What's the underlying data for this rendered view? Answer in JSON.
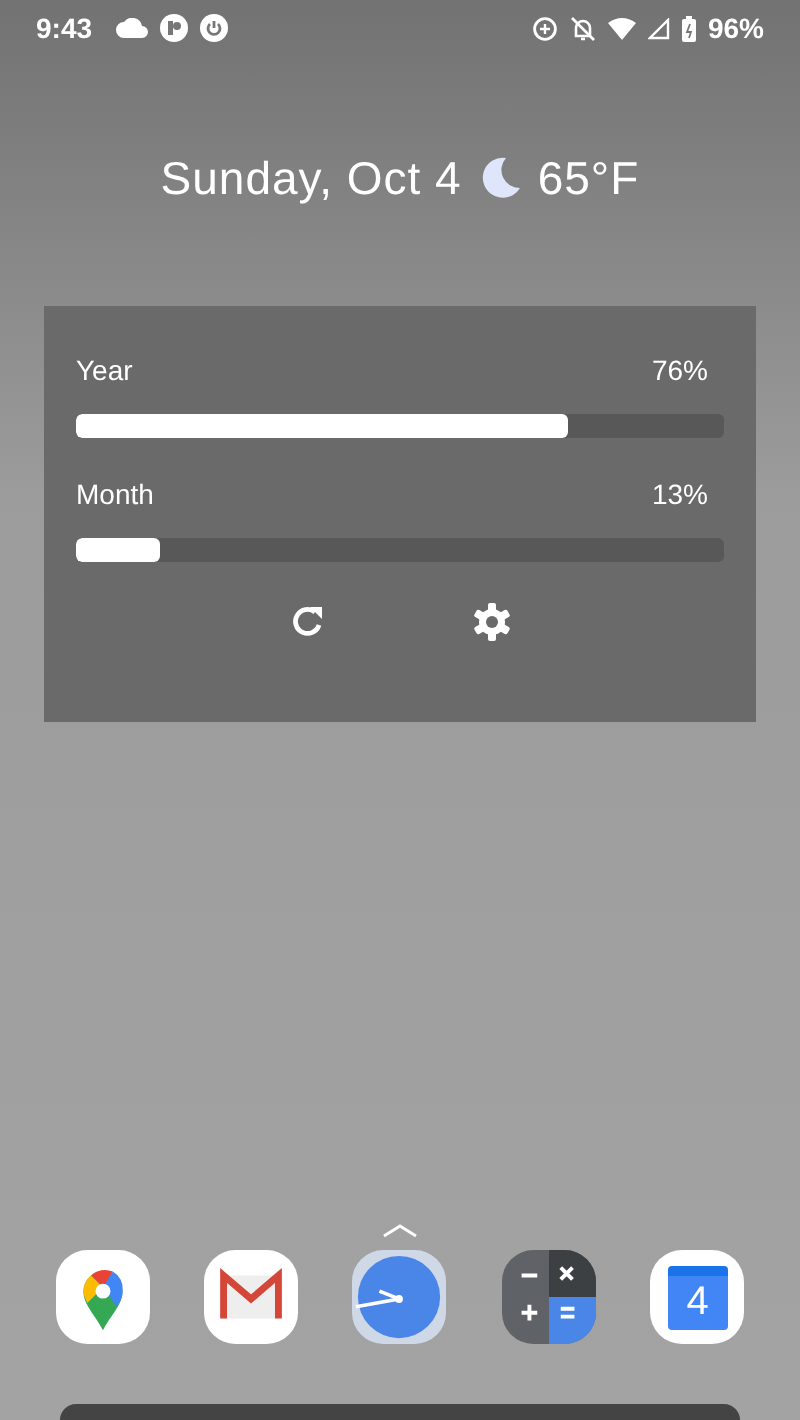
{
  "status_bar": {
    "time": "9:43",
    "battery": "96%"
  },
  "date_line": {
    "date": "Sunday, Oct 4",
    "temperature": "65°F"
  },
  "widget": {
    "bars": [
      {
        "label": "Year",
        "reading": "76%",
        "level": 0.76
      },
      {
        "label": "Month",
        "reading": "13%",
        "level": 0.13
      }
    ]
  },
  "dock": {
    "apps": [
      {
        "kind": "maps"
      },
      {
        "kind": "mail"
      },
      {
        "kind": "clock"
      },
      {
        "kind": "calculator"
      },
      {
        "kind": "calendar",
        "text": "4"
      }
    ]
  }
}
